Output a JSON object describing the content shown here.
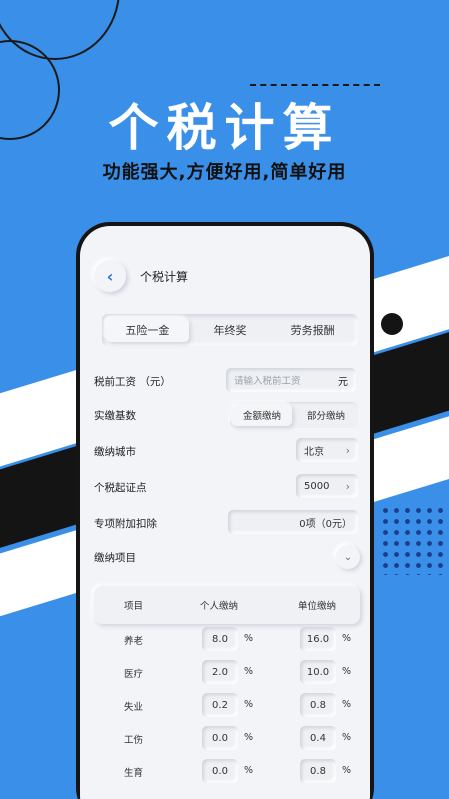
{
  "hero": {
    "title": "个税计算",
    "subtitle": "功能强大,方便好用,简单好用"
  },
  "header": {
    "back_icon": "chevron-left-icon",
    "title": "个税计算"
  },
  "tabs": [
    {
      "label": "五险一金",
      "active": true
    },
    {
      "label": "年终奖",
      "active": false
    },
    {
      "label": "劳务报酬",
      "active": false
    }
  ],
  "form": {
    "salary": {
      "label": "税前工资 （元）",
      "placeholder": "请输入税前工资",
      "unit": "元"
    },
    "base": {
      "label": "实缴基数",
      "options": [
        "金额缴纳",
        "部分缴纳"
      ],
      "selected": "金额缴纳"
    },
    "city": {
      "label": "缴纳城市",
      "value": "北京"
    },
    "threshold": {
      "label": "个税起证点",
      "value": "5000"
    },
    "deduction": {
      "label": "专项附加扣除",
      "value": "0项（0元）"
    },
    "items": {
      "label": "缴纳项目"
    }
  },
  "table": {
    "headers": [
      "项目",
      "个人缴纳",
      "单位缴纳"
    ],
    "unit": "%",
    "rows": [
      {
        "name": "养老",
        "personal": "8.0",
        "company": "16.0"
      },
      {
        "name": "医疗",
        "personal": "2.0",
        "company": "10.0"
      },
      {
        "name": "失业",
        "personal": "0.2",
        "company": "0.8"
      },
      {
        "name": "工伤",
        "personal": "0.0",
        "company": "0.4"
      },
      {
        "name": "生育",
        "personal": "0.0",
        "company": "0.8"
      }
    ]
  },
  "colors": {
    "background": "#3a8fe8",
    "accent": "#2f6fe0",
    "screen": "#f2f4f8"
  }
}
